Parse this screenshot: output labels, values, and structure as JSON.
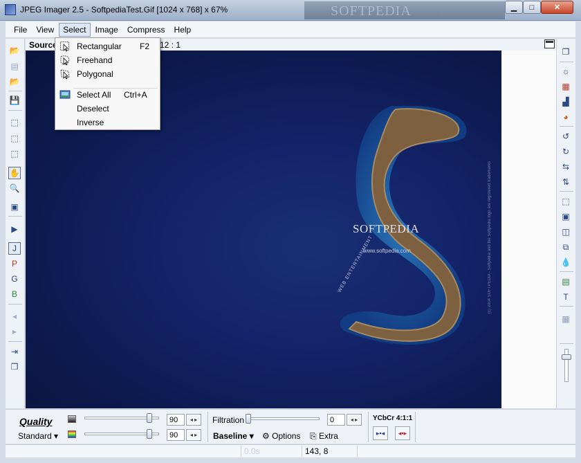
{
  "window": {
    "title": "JPEG Imager 2.5 - SoftpediaTest.Gif [1024 x 768] x 67%",
    "watermark": "SOFTPEDIA",
    "minimize": "▁",
    "maximize": "□",
    "close": "✕"
  },
  "menu": [
    "File",
    "View",
    "Select",
    "Image",
    "Compress",
    "Help"
  ],
  "menu_active": "Select",
  "source": {
    "label": "Source",
    "ratio": "12 : 1"
  },
  "select_menu": {
    "items": [
      {
        "label": "Rectangular",
        "shortcut": "F2",
        "icon": "rect-select-icon"
      },
      {
        "label": "Freehand",
        "shortcut": "",
        "icon": "freehand-select-icon"
      },
      {
        "label": "Polygonal",
        "shortcut": "",
        "icon": "polygon-select-icon"
      },
      {
        "label": "Select All",
        "shortcut": "Ctrl+A",
        "icon": "select-all-icon"
      },
      {
        "label": "Deselect",
        "shortcut": "",
        "icon": ""
      },
      {
        "label": "Inverse",
        "shortcut": "",
        "icon": ""
      }
    ]
  },
  "image": {
    "brand": "SOFTPEDIA",
    "url": "www.softpedia.com",
    "tagline": "WEB ENTERTAINMENT",
    "copyright": "(c) 2004 SOFTPEDIA - Softpedia and the Softpedia logo are registered trademarks"
  },
  "quality": {
    "title": "Quality",
    "preset": "Standard",
    "luma_value": "90",
    "chroma_value": "90",
    "luma_level": 0.9,
    "chroma_level": 0.9
  },
  "filtration": {
    "label": "Filtration",
    "value": "0",
    "level": 0.0
  },
  "encoding": {
    "mode": "Baseline",
    "options": "Options",
    "extra": "Extra",
    "subsampling": "YCbCr 4:1:1"
  },
  "status": {
    "time": "0.0s",
    "coords": "143, 8"
  },
  "colors": {
    "accent": "#2a4a86",
    "image_bg": "#14246a"
  }
}
